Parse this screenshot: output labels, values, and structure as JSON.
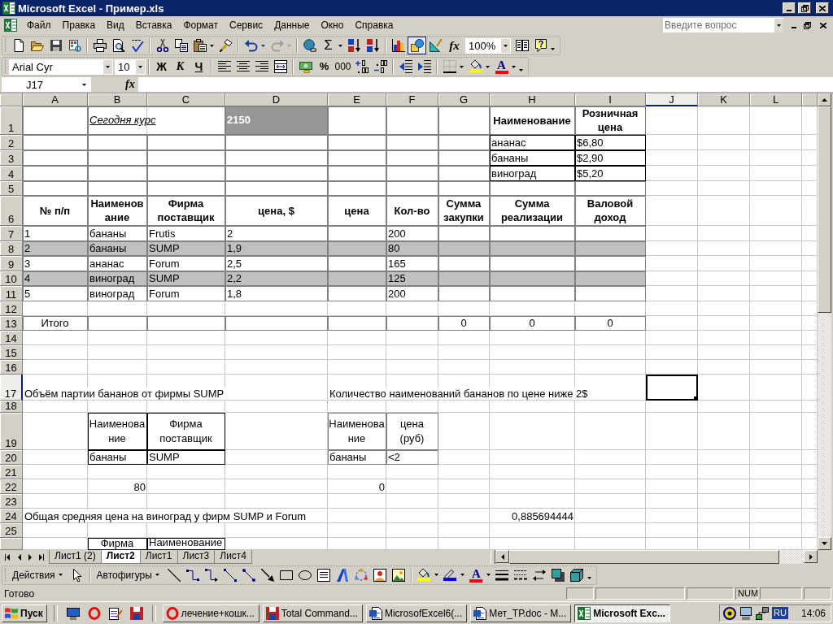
{
  "window": {
    "title": "Microsoft Excel - Пример.xls"
  },
  "menu_bar": {
    "items": [
      "Файл",
      "Правка",
      "Вид",
      "Вставка",
      "Формат",
      "Сервис",
      "Данные",
      "Окно",
      "Справка"
    ],
    "help_search": {
      "placeholder": "Введите вопрос"
    }
  },
  "standard_toolbar": {
    "undo": {
      "disabled": false
    },
    "redo": {
      "disabled": true
    },
    "autosum": "Σ",
    "drawing": {
      "pressed": true
    },
    "function": "fx",
    "zoom": "100%"
  },
  "formatting_toolbar": {
    "font": "Arial Cyr",
    "size": "10",
    "style_buttons": [
      "Ж",
      "К",
      "Ч"
    ],
    "number_buttons": [
      "%",
      "000"
    ],
    "fill_color": {
      "color": "#ffff00"
    },
    "font_color": {
      "label": "A",
      "color": "#ff0000"
    }
  },
  "formula_bar": {
    "name_box": "J17",
    "function": "fx"
  },
  "sheet": {
    "columns": [
      {
        "label": "A",
        "selected": false
      },
      {
        "label": "B",
        "selected": false
      },
      {
        "label": "C",
        "selected": false
      },
      {
        "label": "D",
        "selected": false
      },
      {
        "label": "E",
        "selected": false
      },
      {
        "label": "F",
        "selected": false
      },
      {
        "label": "G",
        "selected": false
      },
      {
        "label": "H",
        "selected": false
      },
      {
        "label": "I",
        "selected": false
      },
      {
        "label": "J",
        "selected": true
      },
      {
        "label": "K",
        "selected": false
      },
      {
        "label": "L",
        "selected": false
      }
    ],
    "rows": [
      {
        "header": "1",
        "selected": false,
        "shaded": false,
        "cells": [
          null,
          {
            "text": "Сегодня курс",
            "kind": "caption"
          },
          null,
          {
            "text": "2150",
            "kind": "highlight"
          },
          null,
          null,
          null,
          {
            "text": "Наименование",
            "kind": "header"
          },
          {
            "text": "Розничная\nцена",
            "kind": "header"
          }
        ]
      },
      {
        "header": "2",
        "selected": false,
        "shaded": false,
        "cells": [
          null,
          null,
          null,
          null,
          null,
          null,
          null,
          {
            "text": "ананас",
            "kind": "plain"
          },
          {
            "text": "$6,80",
            "kind": "plain"
          }
        ]
      },
      {
        "header": "3",
        "selected": false,
        "shaded": false,
        "cells": [
          null,
          null,
          null,
          null,
          null,
          null,
          null,
          {
            "text": "бананы",
            "kind": "plain"
          },
          {
            "text": "$2,90",
            "kind": "plain"
          }
        ]
      },
      {
        "header": "4",
        "selected": false,
        "shaded": false,
        "cells": [
          null,
          null,
          null,
          null,
          null,
          null,
          null,
          {
            "text": "виноград",
            "kind": "plain"
          },
          {
            "text": "$5,20",
            "kind": "plain"
          }
        ]
      },
      {
        "header": "5",
        "selected": false,
        "shaded": false
      },
      {
        "header": "6",
        "selected": false,
        "shaded": false,
        "cells": [
          {
            "text": "№ п/п",
            "kind": "header"
          },
          {
            "text": "Наименов\nание",
            "kind": "header"
          },
          {
            "text": "Фирма\nпоставщик",
            "kind": "header"
          },
          {
            "text": "цена, $",
            "kind": "header"
          },
          {
            "text": "цена",
            "kind": "header"
          },
          {
            "text": "Кол-во",
            "kind": "header"
          },
          {
            "text": "Сумма\nзакупки",
            "kind": "header"
          },
          {
            "text": "Сумма\nреализации",
            "kind": "header"
          },
          {
            "text": "Валовой\nдоход",
            "kind": "header"
          }
        ]
      },
      {
        "header": "7",
        "selected": false,
        "shaded": false,
        "cells": [
          {
            "text": "1",
            "kind": "plain"
          },
          {
            "text": "бананы",
            "kind": "plain"
          },
          {
            "text": "Frutis",
            "kind": "plain"
          },
          {
            "text": "2",
            "kind": "plain"
          },
          null,
          {
            "text": "200",
            "kind": "plain"
          }
        ]
      },
      {
        "header": "8",
        "selected": false,
        "shaded": true,
        "cells": [
          {
            "text": "2",
            "kind": "plain"
          },
          {
            "text": "бананы",
            "kind": "plain"
          },
          {
            "text": "SUMP",
            "kind": "plain"
          },
          {
            "text": "1,9",
            "kind": "plain"
          },
          null,
          {
            "text": "80",
            "kind": "plain"
          }
        ]
      },
      {
        "header": "9",
        "selected": false,
        "shaded": false,
        "cells": [
          {
            "text": "3",
            "kind": "plain"
          },
          {
            "text": "ананас",
            "kind": "plain"
          },
          {
            "text": "Forum",
            "kind": "plain"
          },
          {
            "text": "2,5",
            "kind": "plain"
          },
          null,
          {
            "text": "165",
            "kind": "plain"
          }
        ]
      },
      {
        "header": "10",
        "selected": false,
        "shaded": true,
        "cells": [
          {
            "text": "4",
            "kind": "plain"
          },
          {
            "text": "виноград",
            "kind": "plain"
          },
          {
            "text": "SUMP",
            "kind": "plain"
          },
          {
            "text": "2,2",
            "kind": "plain"
          },
          null,
          {
            "text": "125",
            "kind": "plain"
          }
        ]
      },
      {
        "header": "11",
        "selected": false,
        "shaded": false,
        "cells": [
          {
            "text": "5",
            "kind": "plain"
          },
          {
            "text": "виноград",
            "kind": "plain"
          },
          {
            "text": "Forum",
            "kind": "plain"
          },
          {
            "text": "1,8",
            "kind": "plain"
          },
          null,
          {
            "text": "200",
            "kind": "plain"
          }
        ]
      },
      {
        "header": "12",
        "selected": false,
        "shaded": false
      },
      {
        "header": "13",
        "selected": false,
        "shaded": false,
        "cells": [
          {
            "text": "Итого",
            "kind": "center"
          },
          null,
          null,
          null,
          null,
          null,
          {
            "text": "0",
            "kind": "center"
          },
          {
            "text": "0",
            "kind": "center"
          },
          {
            "text": "0",
            "kind": "center"
          }
        ]
      },
      {
        "header": "14",
        "selected": false,
        "shaded": false
      },
      {
        "header": "15",
        "selected": false,
        "shaded": false
      },
      {
        "header": "16",
        "selected": false,
        "shaded": false
      },
      {
        "header": "17",
        "selected": true,
        "shaded": false,
        "cells": [
          {
            "text": "Объём партии бананов от фирмы SUMP",
            "kind": "spill"
          },
          null,
          null,
          null,
          {
            "text": "Количество наименований бананов по цене ниже 2$",
            "kind": "spill"
          }
        ]
      },
      {
        "header": "18",
        "selected": false,
        "shaded": false
      },
      {
        "header": "19",
        "selected": false,
        "shaded": false,
        "cells": [
          null,
          {
            "text": "Наименова\nние",
            "kind": "center"
          },
          {
            "text": "Фирма\nпоставщик",
            "kind": "center"
          },
          null,
          {
            "text": "Наименова\nние",
            "kind": "center"
          },
          {
            "text": "цена\n(руб)",
            "kind": "center"
          }
        ]
      },
      {
        "header": "20",
        "selected": false,
        "shaded": false,
        "cells": [
          null,
          {
            "text": "бананы",
            "kind": "plain"
          },
          {
            "text": "SUMP",
            "kind": "plain"
          },
          null,
          {
            "text": "бананы",
            "kind": "plain"
          },
          {
            "text": "<2",
            "kind": "plain"
          }
        ]
      },
      {
        "header": "21",
        "selected": false,
        "shaded": false
      },
      {
        "header": "22",
        "selected": false,
        "shaded": false,
        "cells": [
          null,
          {
            "text": "80",
            "kind": "number"
          },
          null,
          null,
          {
            "text": "0",
            "kind": "number"
          }
        ]
      },
      {
        "header": "23",
        "selected": false,
        "shaded": false
      },
      {
        "header": "24",
        "selected": false,
        "shaded": false,
        "cells": [
          {
            "text": "Общая средняя цена на виноград у фирм SUMP и Forum",
            "kind": "spill"
          },
          null,
          null,
          null,
          null,
          null,
          null,
          {
            "text": "0,885694444",
            "kind": "number"
          }
        ]
      },
      {
        "header": "25",
        "selected": false,
        "shaded": false
      },
      {
        "selected": false,
        "shaded": false,
        "cells": [
          null,
          {
            "text": "Фирма",
            "kind": "center"
          },
          {
            "text": "Наименование",
            "kind": "plain"
          }
        ]
      }
    ]
  },
  "sheet_tabs": [
    {
      "label": "Лист1 (2)",
      "selected": false
    },
    {
      "label": "Лист2",
      "selected": true
    },
    {
      "label": "Лист1",
      "selected": false
    },
    {
      "label": "Лист3",
      "selected": false
    },
    {
      "label": "Лист4",
      "selected": false
    }
  ],
  "drawing_toolbar": {
    "actions": "Действия",
    "autoshapes": "Автофигуры",
    "fill_color": {
      "color": "#ffff00"
    },
    "line_color": {
      "color": "#0000ff"
    },
    "font_color": {
      "label": "A",
      "color": "#ff0000"
    }
  },
  "status_bar": {
    "message": "Готово",
    "indicator": "NUM"
  },
  "taskbar": {
    "start": "Пуск",
    "tasks": [
      {
        "label": "лечение+кошк...",
        "selected": false
      },
      {
        "label": "Total Command...",
        "selected": false
      },
      {
        "label": "MicrosofExcel6(...",
        "selected": false
      },
      {
        "label": "Мет_ТР.doc - M...",
        "selected": false
      },
      {
        "label": "Microsoft Exc...",
        "selected": true
      }
    ],
    "language": "RU",
    "clock": "14:06"
  }
}
